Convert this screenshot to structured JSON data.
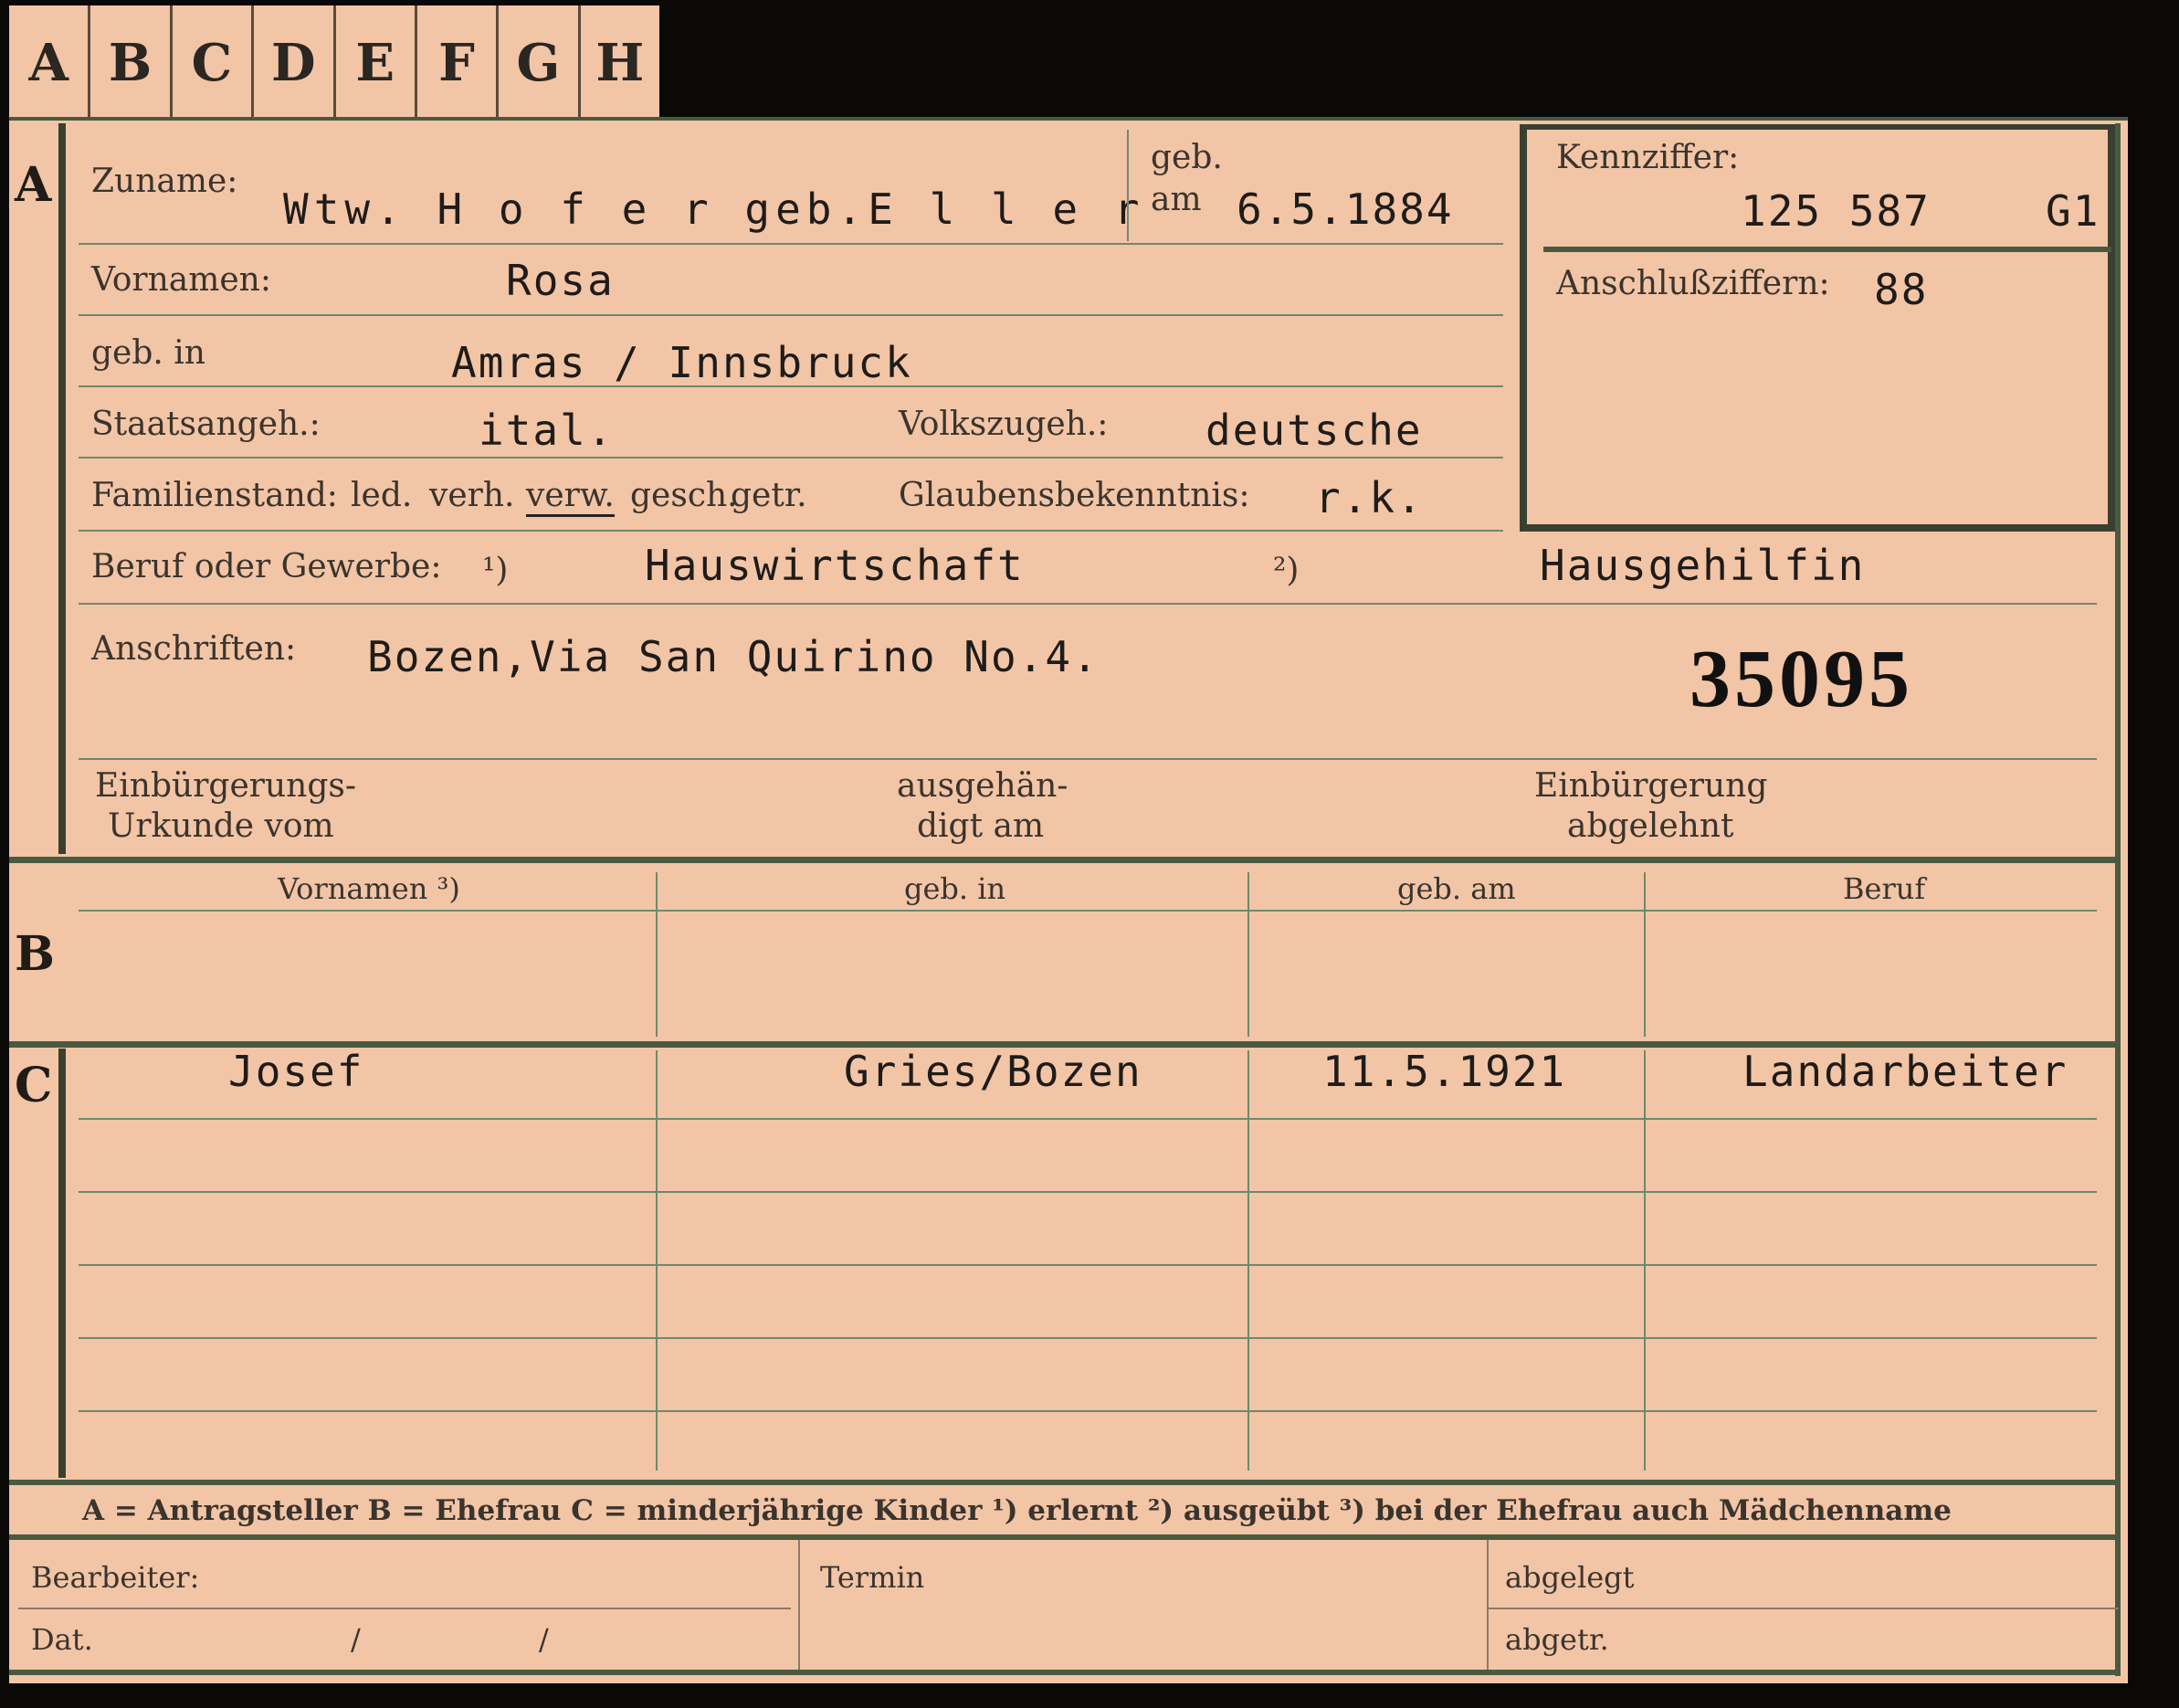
{
  "tabs": [
    "A",
    "B",
    "C",
    "D",
    "E",
    "F",
    "G",
    "H"
  ],
  "section_a": {
    "marker": "A",
    "zuname_label": "Zuname:",
    "zuname_value": "Wtw. H o f e r  geb.E l l e r",
    "geb_label": "geb.",
    "am_label": "am",
    "geb_am_value": "6.5.1884",
    "kennziffer_label": "Kennziffer:",
    "kennziffer_value": "125 587",
    "kennziffer_suffix": "G1",
    "anschluss_label": "Anschlußziffern:",
    "anschluss_value": "88",
    "vornamen_label": "Vornamen:",
    "vornamen_value": "Rosa",
    "geb_in_label": "geb. in",
    "geb_in_value": "Amras / Innsbruck",
    "staatsangeh_label": "Staatsangeh.:",
    "staatsangeh_value": "ital.",
    "volkszugeh_label": "Volkszugeh.:",
    "volkszugeh_value": "deutsche",
    "familienstand_label": "Familienstand:",
    "familienstand_options": [
      "led.",
      "verh.",
      "verw.",
      "gesch.",
      "getr."
    ],
    "glaubens_label": "Glaubensbekenntnis:",
    "glaubens_value": "r.k.",
    "beruf_label": "Beruf oder Gewerbe:",
    "beruf_note1": "¹)",
    "beruf_value1": "Hauswirtschaft",
    "beruf_note2": "²)",
    "beruf_value2": "Hausgehilfin",
    "anschriften_label": "Anschriften:",
    "anschriften_value": "Bozen,Via San Quirino No.4.",
    "stamp_number": "35095",
    "einb_label_1": "Einbürgerungs-",
    "einb_label_2": "Urkunde vom",
    "ausg_label_1": "ausgehän-",
    "ausg_label_2": "digt am",
    "abg_label_1": "Einbürgerung",
    "abg_label_2": "abgelehnt"
  },
  "section_b": {
    "marker": "B",
    "headers": [
      "Vornamen ³)",
      "geb. in",
      "geb. am",
      "Beruf"
    ]
  },
  "section_c": {
    "marker": "C",
    "rows": [
      {
        "vorname": "Josef",
        "geb_in": "Gries/Bozen",
        "geb_am": "11.5.1921",
        "beruf": "Landarbeiter"
      }
    ]
  },
  "legend": "A = Antragsteller   B = Ehefrau   C = minderjährige Kinder   ¹) erlernt   ²) ausgeübt   ³) bei der Ehefrau auch Mädchenname",
  "footer": {
    "bearbeiter_label": "Bearbeiter:",
    "dat_label": "Dat.",
    "slash1": "/",
    "slash2": "/",
    "termin_label": "Termin",
    "abgelegt_label": "abgelegt",
    "abgetr_label": "abgetr."
  }
}
